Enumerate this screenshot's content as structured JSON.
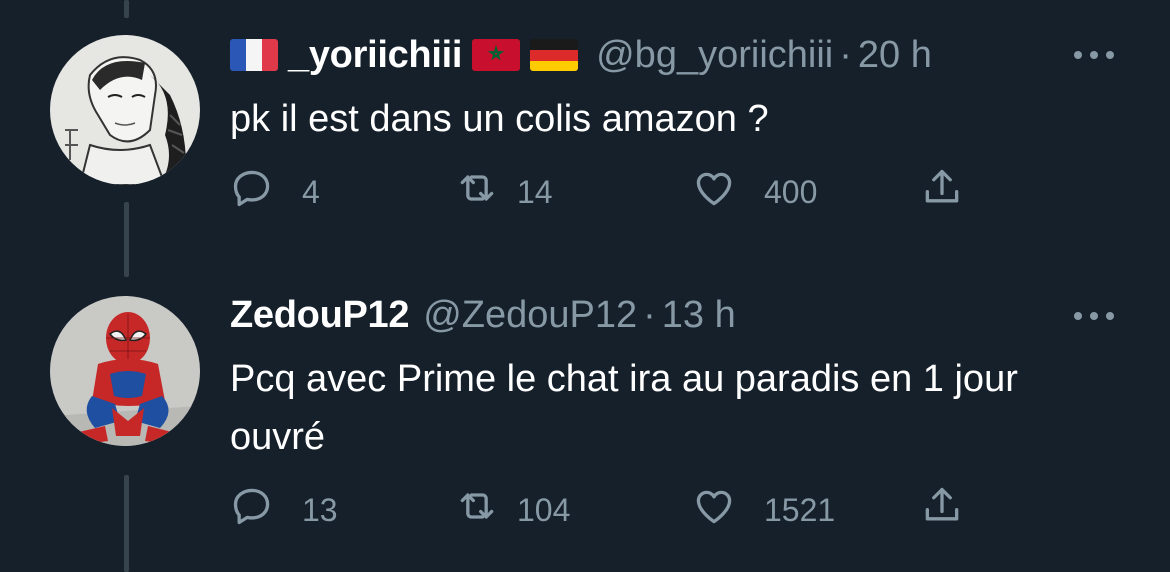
{
  "tweets": [
    {
      "display_name": "_yoriichiii",
      "handle": "@bg_yoriichiii",
      "separator": "·",
      "time": "20 h",
      "text": "pk il est dans un colis amazon ?",
      "flags": [
        "france-flag",
        "morocco-flag",
        "germany-flag"
      ],
      "replies": "4",
      "retweets": "14",
      "likes": "400"
    },
    {
      "display_name": "ZedouP12",
      "handle": "@ZedouP12",
      "separator": "·",
      "time": "13 h",
      "text": "Pcq avec Prime le chat ira au paradis en 1 jour ouvré",
      "replies": "13",
      "retweets": "104",
      "likes": "1521"
    }
  ],
  "colors": {
    "background": "#15202b",
    "text_primary": "#ffffff",
    "text_secondary": "#8899a6",
    "thread_line": "#38444d"
  },
  "icons": [
    "reply-icon",
    "retweet-icon",
    "like-icon",
    "share-icon",
    "more-icon"
  ]
}
